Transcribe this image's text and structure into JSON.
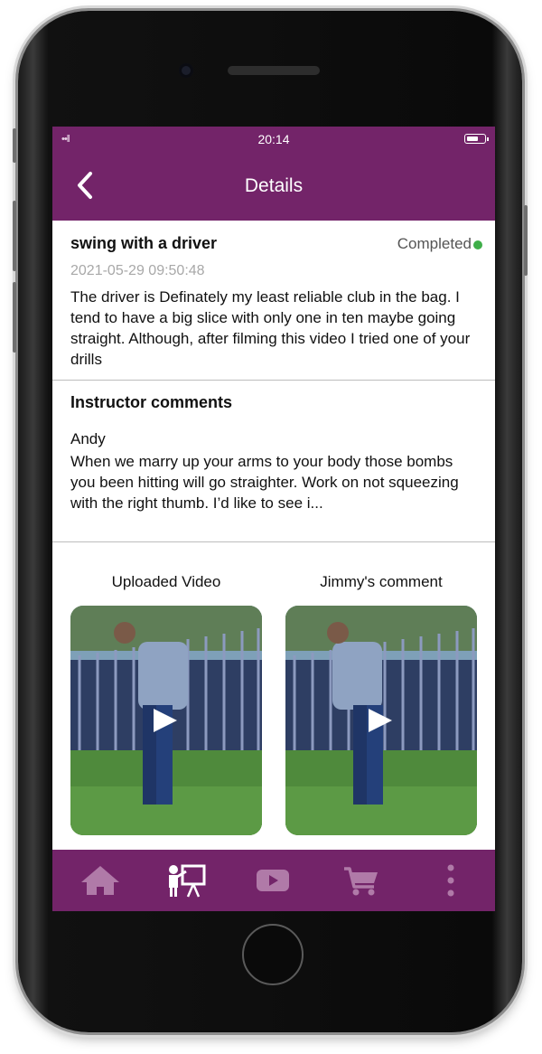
{
  "status_bar": {
    "time": "20:14",
    "signal": "••ll"
  },
  "navbar": {
    "title": "Details"
  },
  "task": {
    "title": "swing with a driver",
    "status": "Completed",
    "status_color": "#3fae49",
    "date": "2021-05-29 09:50:48",
    "description": "The driver is Definately my least reliable club in the bag. I tend to have a big slice with only one in ten maybe going straight. Although, after filming this video I tried one of your drills"
  },
  "instructor": {
    "heading": "Instructor comments",
    "name": "Andy",
    "comment": "When we marry up your arms to your body those bombs you been hitting will go straighter.  Work on not squeezing with the right thumb. I’d like to see i..."
  },
  "videos": [
    {
      "label": "Uploaded Video",
      "icon": "play-icon"
    },
    {
      "label": "Jimmy's comment",
      "icon": "play-icon"
    }
  ],
  "tabbar": {
    "items": [
      {
        "icon": "home-icon",
        "active": false
      },
      {
        "icon": "instructor-board-icon",
        "active": true
      },
      {
        "icon": "video-play-icon",
        "active": false
      },
      {
        "icon": "cart-icon",
        "active": false
      },
      {
        "icon": "more-vertical-icon",
        "active": false
      }
    ]
  },
  "colors": {
    "brand": "#732469",
    "inactive_icon": "#b07aa8",
    "active_icon": "#ffffff"
  }
}
